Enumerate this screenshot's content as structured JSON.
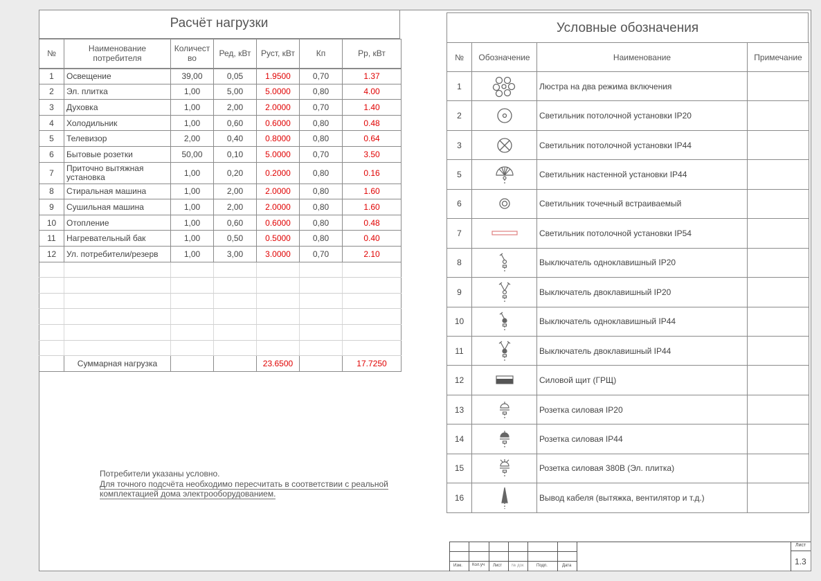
{
  "load_table": {
    "title": "Расчёт нагрузки",
    "headers": [
      "№",
      "Наименование потребителя",
      "Количество",
      "Ред, кВт",
      "Руст, кВт",
      "Кп",
      "Рр, кВт"
    ],
    "header_display": {
      "name_line1": "Наименование",
      "name_line2": "потребителя",
      "qty_line1": "Количест",
      "qty_line2": "во"
    },
    "rows": [
      {
        "n": "1",
        "name": "Освещение",
        "qty": "39,00",
        "ped": "0,05",
        "pust": "1.9500",
        "kp": "0,70",
        "pr": "1.37"
      },
      {
        "n": "2",
        "name": "Эл. плитка",
        "qty": "1,00",
        "ped": "5,00",
        "pust": "5.0000",
        "kp": "0,80",
        "pr": "4.00"
      },
      {
        "n": "3",
        "name": "Духовка",
        "qty": "1,00",
        "ped": "2,00",
        "pust": "2.0000",
        "kp": "0,70",
        "pr": "1.40"
      },
      {
        "n": "4",
        "name": "Холодильник",
        "qty": "1,00",
        "ped": "0,60",
        "pust": "0.6000",
        "kp": "0,80",
        "pr": "0.48"
      },
      {
        "n": "5",
        "name": "Телевизор",
        "qty": "2,00",
        "ped": "0,40",
        "pust": "0.8000",
        "kp": "0,80",
        "pr": "0.64"
      },
      {
        "n": "6",
        "name": "Бытовые розетки",
        "qty": "50,00",
        "ped": "0,10",
        "pust": "5.0000",
        "kp": "0,70",
        "pr": "3.50"
      },
      {
        "n": "7",
        "name": "Приточно вытяжная установка",
        "qty": "1,00",
        "ped": "0,20",
        "pust": "0.2000",
        "kp": "0,80",
        "pr": "0.16"
      },
      {
        "n": "8",
        "name": "Стиральная машина",
        "qty": "1,00",
        "ped": "2,00",
        "pust": "2.0000",
        "kp": "0,80",
        "pr": "1.60"
      },
      {
        "n": "9",
        "name": "Сушильная машина",
        "qty": "1,00",
        "ped": "2,00",
        "pust": "2.0000",
        "kp": "0,80",
        "pr": "1.60"
      },
      {
        "n": "10",
        "name": "Отопление",
        "qty": "1,00",
        "ped": "0,60",
        "pust": "0.6000",
        "kp": "0,80",
        "pr": "0.48"
      },
      {
        "n": "11",
        "name": "Нагревательный бак",
        "qty": "1,00",
        "ped": "0,50",
        "pust": "0.5000",
        "kp": "0,80",
        "pr": "0.40"
      },
      {
        "n": "12",
        "name": "Ул. потребители/резерв",
        "qty": "1,00",
        "ped": "3,00",
        "pust": "3.0000",
        "kp": "0,70",
        "pr": "2.10"
      }
    ],
    "total": {
      "label": "Суммарная нагрузка",
      "pust": "23.6500",
      "pr": "17.7250"
    }
  },
  "note": {
    "line1": "Потребители указаны условно.",
    "line2": "Для точного подсчёта необходимо пересчитать в соответствии с реальной",
    "line3": "комплектацией дома электрооборудованием."
  },
  "legend": {
    "title": "Условные обозначения",
    "headers": [
      "№",
      "Обозначение",
      "Наименование",
      "Примечание"
    ],
    "rows": [
      {
        "n": "1",
        "icon": "chandelier-icon",
        "name": "Люстра на два режима включения"
      },
      {
        "n": "2",
        "icon": "ceiling-light-ip20-icon",
        "name": "Светильник потолочной установки IP20"
      },
      {
        "n": "3",
        "icon": "ceiling-light-ip44-icon",
        "name": "Светильник потолочной установки IP44"
      },
      {
        "n": "5",
        "icon": "wall-light-ip44-icon",
        "name": "Светильник настенной установки IP44"
      },
      {
        "n": "6",
        "icon": "spot-light-icon",
        "name": "Светильник точечный встраиваемый"
      },
      {
        "n": "7",
        "icon": "linear-light-ip54-icon",
        "name": "Светильник потолочной установки IP54"
      },
      {
        "n": "8",
        "icon": "switch-single-ip20-icon",
        "name": "Выключатель одноклавишный IP20"
      },
      {
        "n": "9",
        "icon": "switch-double-ip20-icon",
        "name": "Выключатель двоклавишный IP20"
      },
      {
        "n": "10",
        "icon": "switch-single-ip44-icon",
        "name": "Выключатель одноклавишный IP44"
      },
      {
        "n": "11",
        "icon": "switch-double-ip44-icon",
        "name": "Выключатель двоклавишный IP44"
      },
      {
        "n": "12",
        "icon": "power-panel-icon",
        "name": "Силовой щит (ГРЩ)"
      },
      {
        "n": "13",
        "icon": "socket-ip20-icon",
        "name": "Розетка силовая IP20"
      },
      {
        "n": "14",
        "icon": "socket-ip44-icon",
        "name": "Розетка силовая IP44"
      },
      {
        "n": "15",
        "icon": "socket-380v-icon",
        "name": "Розетка силовая 380В (Эл. плитка)"
      },
      {
        "n": "16",
        "icon": "cable-outlet-icon",
        "name": "Вывод кабеля (вытяжка, вентилятор и т.д.)"
      }
    ]
  },
  "stamp": {
    "izm": "Изм.",
    "kol": "Кол.уч",
    "list": "Лист",
    "ndoc": "№ док",
    "podp": "Подп.",
    "data": "Дата",
    "sheet_label": "Лист",
    "sheet_number": "1.3"
  },
  "colors": {
    "accent_red": "#e00000",
    "line": "#8a8a8a"
  }
}
